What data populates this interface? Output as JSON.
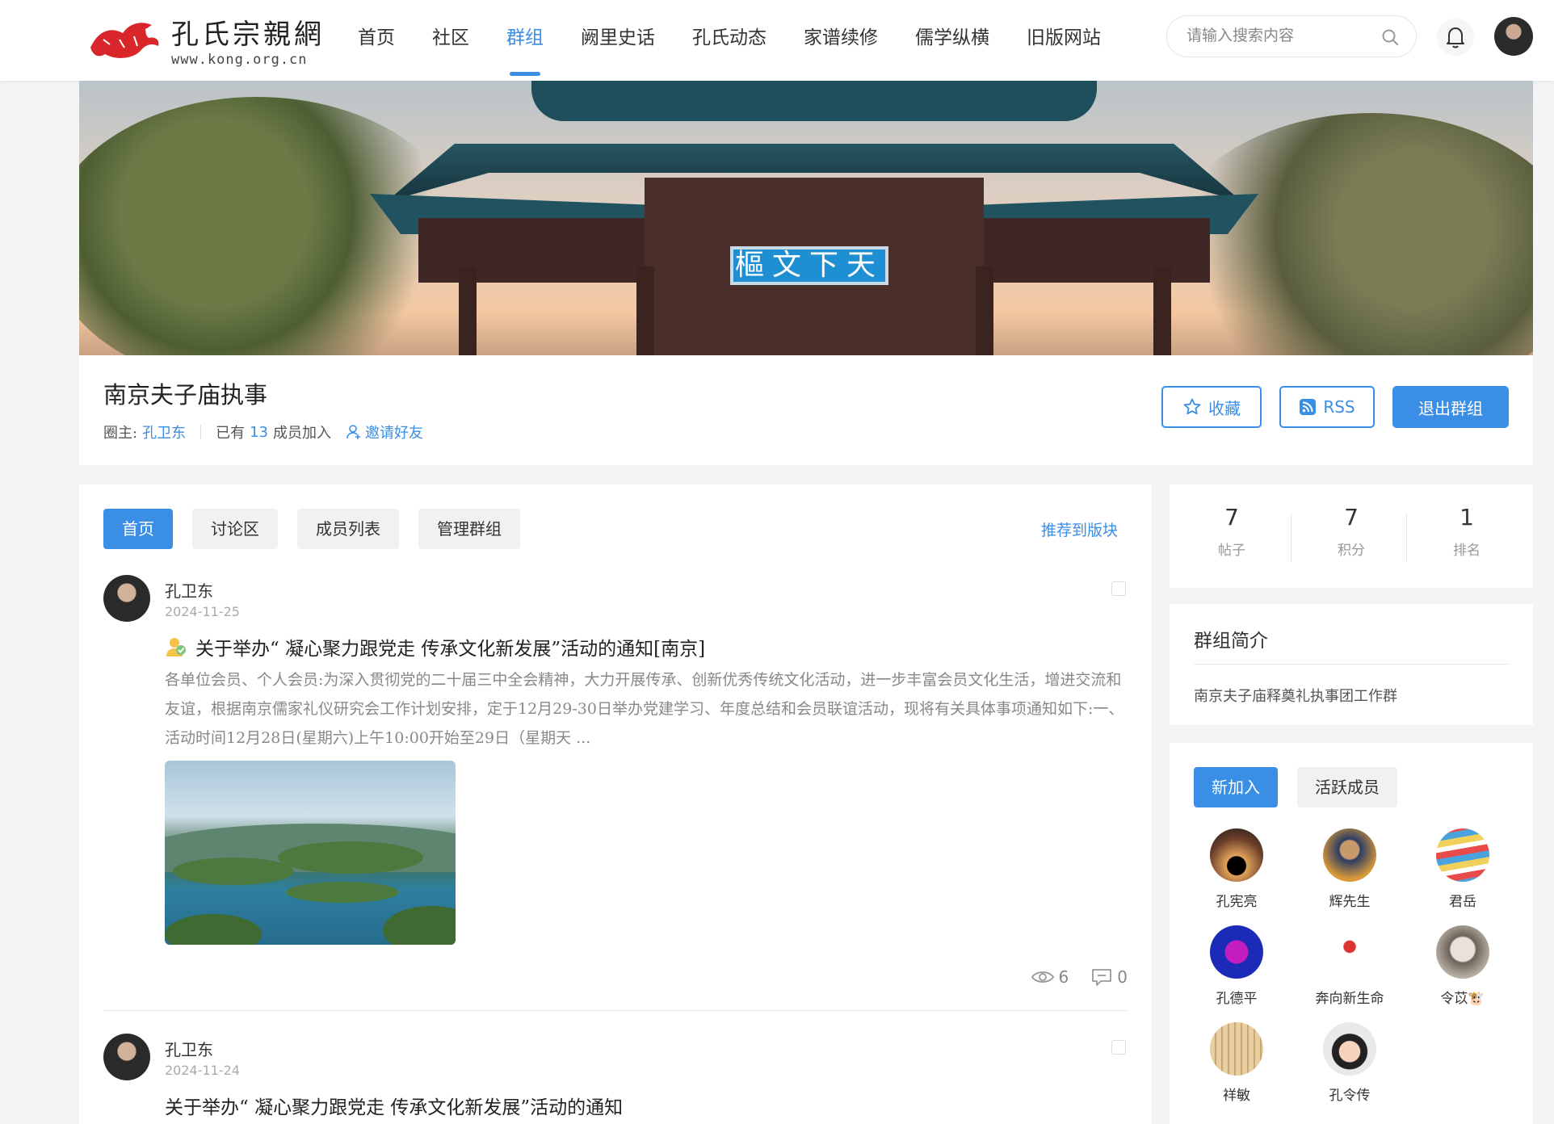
{
  "header": {
    "logo_title": "孔氏宗親網",
    "logo_sub": "www.kong.org.cn",
    "nav": [
      "首页",
      "社区",
      "群组",
      "阙里史话",
      "孔氏动态",
      "家谱续修",
      "儒学纵横",
      "旧版网站"
    ],
    "active_nav": 2,
    "search_placeholder": "请输入搜索内容"
  },
  "banner": {
    "plaque_text": "天下文樞"
  },
  "group": {
    "title": "南京夫子庙执事",
    "owner_label": "圈主:",
    "owner_name": "孔卫东",
    "members_prefix": "已有",
    "member_count": "13",
    "members_suffix": "成员加入",
    "invite_label": "邀请好友",
    "fav_label": "收藏",
    "rss_label": "RSS",
    "quit_label": "退出群组"
  },
  "main": {
    "tabs": [
      "首页",
      "讨论区",
      "成员列表",
      "管理群组"
    ],
    "recommend_label": "推荐到版块",
    "posts": [
      {
        "author": "孔卫东",
        "date": "2024-11-25",
        "title": "关于举办“ 凝心聚力跟党走 传承文化新发展”活动的通知[南京]",
        "excerpt": "各单位会员、个人会员:为深入贯彻党的二十届三中全会精神，大力开展传承、创新优秀传统文化活动，进一步丰富会员文化生活，增进交流和友谊，根据南京儒家礼仪研究会工作计划安排，定于12月29-30日举办党建学习、年度总结和会员联谊活动，现将有关具体事项通知如下:一、活动时间12月28日(星期六)上午10:00开始至29日（星期天 ...",
        "views": "6",
        "comments": "0"
      },
      {
        "author": "孔卫东",
        "date": "2024-11-24",
        "title": "关于举办“ 凝心聚力跟党走 传承文化新发展”活动的通知"
      }
    ]
  },
  "sidebar": {
    "stats": [
      {
        "value": "7",
        "label": "帖子"
      },
      {
        "value": "7",
        "label": "积分"
      },
      {
        "value": "1",
        "label": "排名"
      }
    ],
    "intro_title": "群组简介",
    "intro_text": "南京夫子庙释奠礼执事团工作群",
    "member_tabs": [
      "新加入",
      "活跃成员"
    ],
    "members": [
      "孔宪亮",
      "辉先生",
      "君岳",
      "孔德平",
      "奔向新生命",
      "令苡🐮",
      "祥敏",
      "孔令传"
    ]
  },
  "colors": {
    "accent": "#3a8ee6",
    "page_bg": "#f3f4f6"
  }
}
